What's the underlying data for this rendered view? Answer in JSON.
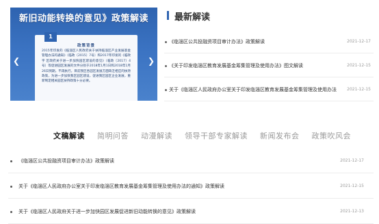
{
  "banner": {
    "title": "新旧动能转换的意见》政策解读",
    "paper_icon": "1",
    "paper_heading": "政策背景",
    "paper_text": "2015年印发的《临淄区人民政府关于扶持临淄区产业发展基金管理办法的通知》（临政〔2015〕7号）和2017年印发的《临政字 区政府关于进一步加快园区建设的意见》（临政〔2017〕4号）等促进园区发展的文件分别于2018年1月1日和2018年1月26日到期，不再执行。目前我区各园区发展方面缺乏相应的扶持政策，为进一步加快我区园区建设，促进我区园区企业发展，重新制定相关园区扶持政策十分必要。",
    "prev_icon": "chevron-left-icon",
    "next_icon": "chevron-right-icon"
  },
  "latest": {
    "title": "最新解读",
    "items": [
      {
        "text": "《临淄区公共投融资项目审计办法》政策解读",
        "date": "2021-12-17"
      },
      {
        "text": "《关于印发临淄区教育发展基金筹集管理及使用办法》图文解读",
        "date": "2021-12-15"
      },
      {
        "text": "关于《临淄区人民政府办公室关于印发临淄区教育发展基金筹集管理及使用办法",
        "date": "2021-12-15"
      }
    ]
  },
  "tabs": [
    {
      "label": "文稿解读",
      "active": true
    },
    {
      "label": "简明问答",
      "active": false
    },
    {
      "label": "动漫解读",
      "active": false
    },
    {
      "label": "领导干部专家解读",
      "active": false
    },
    {
      "label": "新闻发布会",
      "active": false
    },
    {
      "label": "政策吹风会",
      "active": false
    }
  ],
  "docs": [
    {
      "text": "《临淄区公共投融资项目审计办法》政策解读",
      "date": "2021-12-17"
    },
    {
      "text": "关于《临淄区人民政府办公室关于印发临淄区教育发展基金筹集管理及使用办法的通知》政策解读",
      "date": "2021-12-15"
    },
    {
      "text": "关于《临淄区人民政府关于进一步加快园区发展促进新旧动能转换的意见》政策解读",
      "date": "2021-12-13"
    }
  ]
}
